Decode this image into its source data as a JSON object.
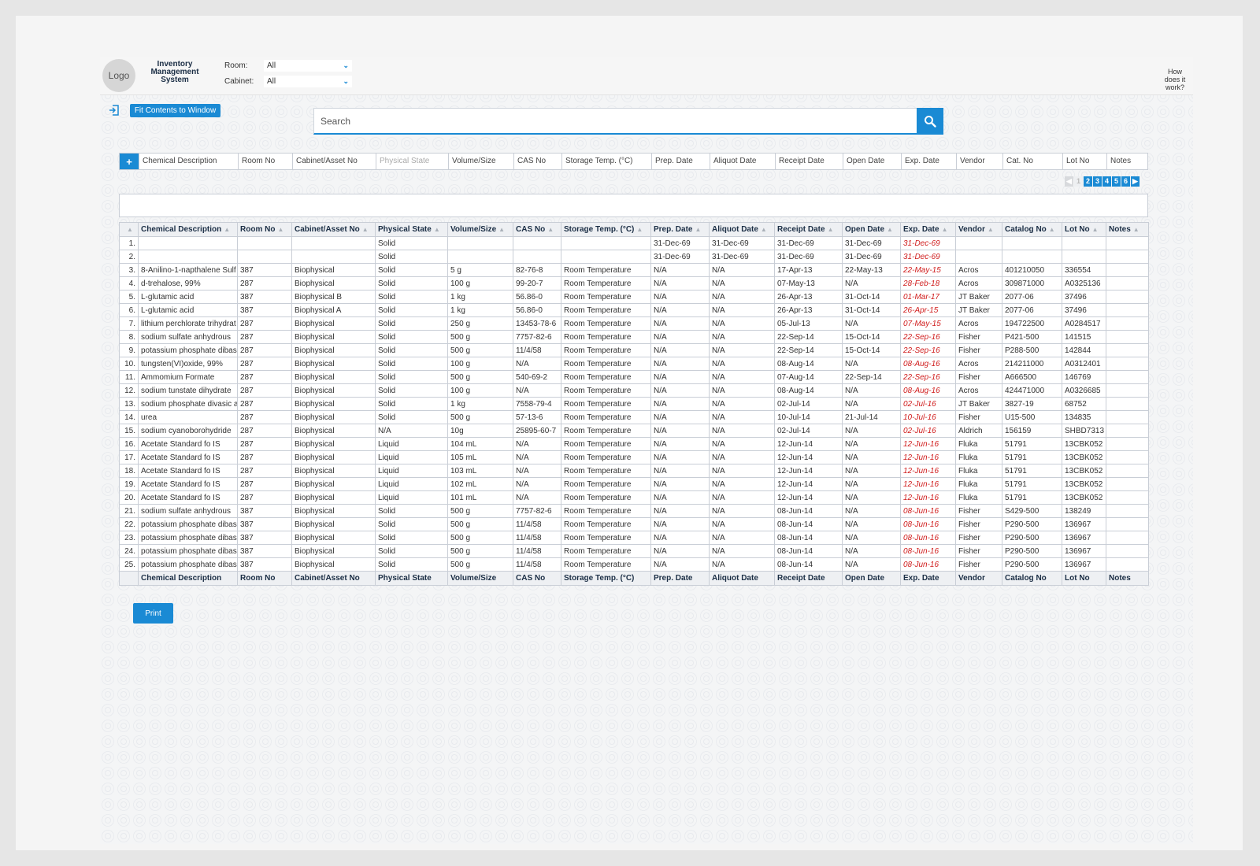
{
  "header": {
    "logo": "Logo",
    "title_lines": [
      "Inventory",
      "Management",
      "System"
    ],
    "room_label": "Room:",
    "room_value": "All",
    "cabinet_label": "Cabinet:",
    "cabinet_value": "All",
    "how_lines": [
      "How",
      "does it",
      "work?"
    ]
  },
  "toolbar": {
    "fit_label": "Fit Contents to Window"
  },
  "search": {
    "placeholder": "Search"
  },
  "column_bar": {
    "add_label": "+",
    "items": [
      "Chemical Description",
      "Room No",
      "Cabinet/Asset No",
      "Physical State",
      "Volume/Size",
      "CAS No",
      "Storage Temp. (°C)",
      "Prep. Date",
      "Aliquot Date",
      "Receipt Date",
      "Open Date",
      "Exp. Date",
      "Vendor",
      "Cat. No",
      "Lot No",
      "Notes"
    ]
  },
  "pager": {
    "pages": [
      "1",
      "2",
      "3",
      "4",
      "5",
      "6"
    ],
    "current": "1"
  },
  "table": {
    "headers": [
      "Chemical Description",
      "Room No",
      "Cabinet/Asset No",
      "Physical State",
      "Volume/Size",
      "CAS No",
      "Storage Temp. (°C)",
      "Prep. Date",
      "Aliquot Date",
      "Receipt Date",
      "Open Date",
      "Exp. Date",
      "Vendor",
      "Catalog No",
      "Lot No",
      "Notes"
    ],
    "rows": [
      [
        "1.",
        "",
        "",
        "",
        "Solid",
        "",
        "",
        "",
        "31-Dec-69",
        "31-Dec-69",
        "31-Dec-69",
        "31-Dec-69",
        "31-Dec-69",
        "",
        "",
        "",
        ""
      ],
      [
        "2.",
        "",
        "",
        "",
        "Solid",
        "",
        "",
        "",
        "31-Dec-69",
        "31-Dec-69",
        "31-Dec-69",
        "31-Dec-69",
        "31-Dec-69",
        "",
        "",
        "",
        ""
      ],
      [
        "3.",
        "8-Anilino-1-napthalene Sulf",
        "387",
        "Biophysical",
        "Solid",
        "5 g",
        "82-76-8",
        "Room Temperature",
        "N/A",
        "N/A",
        "17-Apr-13",
        "22-May-13",
        "22-May-15",
        "Acros",
        "401210050",
        "336554",
        ""
      ],
      [
        "4.",
        "d-trehalose, 99%",
        "287",
        "Biophysical",
        "Solid",
        "100 g",
        "99-20-7",
        "Room Temperature",
        "N/A",
        "N/A",
        "07-May-13",
        "N/A",
        "28-Feb-18",
        "Acros",
        "309871000",
        "A0325136",
        ""
      ],
      [
        "5.",
        "L-glutamic acid",
        "387",
        "Biophysical B",
        "Solid",
        "1 kg",
        "56.86-0",
        "Room Temperature",
        "N/A",
        "N/A",
        "26-Apr-13",
        "31-Oct-14",
        "01-Mar-17",
        "JT Baker",
        "2077-06",
        "37496",
        ""
      ],
      [
        "6.",
        "L-glutamic acid",
        "387",
        "Biophysical A",
        "Solid",
        "1 kg",
        "56.86-0",
        "Room Temperature",
        "N/A",
        "N/A",
        "26-Apr-13",
        "31-Oct-14",
        "26-Apr-15",
        "JT Baker",
        "2077-06",
        "37496",
        ""
      ],
      [
        "7.",
        "lithium perchlorate trihydrat",
        "287",
        "Biophysical",
        "Solid",
        "250 g",
        "13453-78-6",
        "Room Temperature",
        "N/A",
        "N/A",
        "05-Jul-13",
        "N/A",
        "07-May-15",
        "Acros",
        "194722500",
        "A0284517",
        ""
      ],
      [
        "8.",
        "sodium sulfate anhydrous",
        "287",
        "Biophysical",
        "Solid",
        "500 g",
        "7757-82-6",
        "Room Temperature",
        "N/A",
        "N/A",
        "22-Sep-14",
        "15-Oct-14",
        "22-Sep-16",
        "Fisher",
        "P421-500",
        "141515",
        ""
      ],
      [
        "9.",
        "potassium phosphate dibas",
        "287",
        "Biophysical",
        "Solid",
        "500 g",
        "11/4/58",
        "Room Temperature",
        "N/A",
        "N/A",
        "22-Sep-14",
        "15-Oct-14",
        "22-Sep-16",
        "Fisher",
        "P288-500",
        "142844",
        ""
      ],
      [
        "10.",
        "tungsten(VI)oxide, 99%",
        "287",
        "Biophysical",
        "Solid",
        "100 g",
        "N/A",
        "Room Temperature",
        "N/A",
        "N/A",
        "08-Aug-14",
        "N/A",
        "08-Aug-16",
        "Acros",
        "214211000",
        "A0312401",
        ""
      ],
      [
        "11.",
        "Ammomium Formate",
        "287",
        "Biophysical",
        "Solid",
        "500 g",
        "540-69-2",
        "Room Temperature",
        "N/A",
        "N/A",
        "07-Aug-14",
        "22-Sep-14",
        "22-Sep-16",
        "Fisher",
        "A666500",
        "146769",
        ""
      ],
      [
        "12.",
        "sodium tunstate dihydrate",
        "287",
        "Biophysical",
        "Solid",
        "100 g",
        "N/A",
        "Room Temperature",
        "N/A",
        "N/A",
        "08-Aug-14",
        "N/A",
        "08-Aug-16",
        "Acros",
        "424471000",
        "A0326685",
        ""
      ],
      [
        "13.",
        "sodium phosphate divasic a",
        "287",
        "Biophysical",
        "Solid",
        "1 kg",
        "7558-79-4",
        "Room Temperature",
        "N/A",
        "N/A",
        "02-Jul-14",
        "N/A",
        "02-Jul-16",
        "JT Baker",
        "3827-19",
        "68752",
        ""
      ],
      [
        "14.",
        "urea",
        "287",
        "Biophysical",
        "Solid",
        "500 g",
        "57-13-6",
        "Room Temperature",
        "N/A",
        "N/A",
        "10-Jul-14",
        "21-Jul-14",
        "10-Jul-16",
        "Fisher",
        "U15-500",
        "134835",
        ""
      ],
      [
        "15.",
        "sodium cyanoborohydride",
        "287",
        "Biophysical",
        "N/A",
        "10g",
        "25895-60-7",
        "Room Temperature",
        "N/A",
        "N/A",
        "02-Jul-14",
        "N/A",
        "02-Jul-16",
        "Aldrich",
        "156159",
        "SHBD7313",
        ""
      ],
      [
        "16.",
        "Acetate Standard fo IS",
        "287",
        "Biophysical",
        "Liquid",
        "104 mL",
        "N/A",
        "Room Temperature",
        "N/A",
        "N/A",
        "12-Jun-14",
        "N/A",
        "12-Jun-16",
        "Fluka",
        "51791",
        "13CBK052",
        ""
      ],
      [
        "17.",
        "Acetate Standard fo IS",
        "287",
        "Biophysical",
        "Liquid",
        "105 mL",
        "N/A",
        "Room Temperature",
        "N/A",
        "N/A",
        "12-Jun-14",
        "N/A",
        "12-Jun-16",
        "Fluka",
        "51791",
        "13CBK052",
        ""
      ],
      [
        "18.",
        "Acetate Standard fo IS",
        "287",
        "Biophysical",
        "Liquid",
        "103 mL",
        "N/A",
        "Room Temperature",
        "N/A",
        "N/A",
        "12-Jun-14",
        "N/A",
        "12-Jun-16",
        "Fluka",
        "51791",
        "13CBK052",
        ""
      ],
      [
        "19.",
        "Acetate Standard fo IS",
        "287",
        "Biophysical",
        "Liquid",
        "102 mL",
        "N/A",
        "Room Temperature",
        "N/A",
        "N/A",
        "12-Jun-14",
        "N/A",
        "12-Jun-16",
        "Fluka",
        "51791",
        "13CBK052",
        ""
      ],
      [
        "20.",
        "Acetate Standard fo IS",
        "287",
        "Biophysical",
        "Liquid",
        "101 mL",
        "N/A",
        "Room Temperature",
        "N/A",
        "N/A",
        "12-Jun-14",
        "N/A",
        "12-Jun-16",
        "Fluka",
        "51791",
        "13CBK052",
        ""
      ],
      [
        "21.",
        "sodium sulfate anhydrous",
        "387",
        "Biophysical",
        "Solid",
        "500 g",
        "7757-82-6",
        "Room Temperature",
        "N/A",
        "N/A",
        "08-Jun-14",
        "N/A",
        "08-Jun-16",
        "Fisher",
        "S429-500",
        "138249",
        ""
      ],
      [
        "22.",
        "potassium phosphate dibas",
        "387",
        "Biophysical",
        "Solid",
        "500 g",
        "11/4/58",
        "Room Temperature",
        "N/A",
        "N/A",
        "08-Jun-14",
        "N/A",
        "08-Jun-16",
        "Fisher",
        "P290-500",
        "136967",
        ""
      ],
      [
        "23.",
        "potassium phosphate dibas",
        "387",
        "Biophysical",
        "Solid",
        "500 g",
        "11/4/58",
        "Room Temperature",
        "N/A",
        "N/A",
        "08-Jun-14",
        "N/A",
        "08-Jun-16",
        "Fisher",
        "P290-500",
        "136967",
        ""
      ],
      [
        "24.",
        "potassium phosphate dibas",
        "387",
        "Biophysical",
        "Solid",
        "500 g",
        "11/4/58",
        "Room Temperature",
        "N/A",
        "N/A",
        "08-Jun-14",
        "N/A",
        "08-Jun-16",
        "Fisher",
        "P290-500",
        "136967",
        ""
      ],
      [
        "25.",
        "potassium phosphate dibas",
        "387",
        "Biophysical",
        "Solid",
        "500 g",
        "11/4/58",
        "Room Temperature",
        "N/A",
        "N/A",
        "08-Jun-14",
        "N/A",
        "08-Jun-16",
        "Fisher",
        "P290-500",
        "136967",
        ""
      ]
    ]
  },
  "footer": {
    "print_label": "Print"
  },
  "colors": {
    "accent": "#1a8ad4",
    "expired": "#d01c1c",
    "header_text": "#1b2e45"
  },
  "icons": {
    "exit": "exit-icon",
    "search": "search-icon",
    "sort": "sort-arrow-icon",
    "dropdown": "chevron-down-icon",
    "add": "plus-icon",
    "prev": "prev-arrow-icon",
    "next": "next-arrow-icon"
  }
}
